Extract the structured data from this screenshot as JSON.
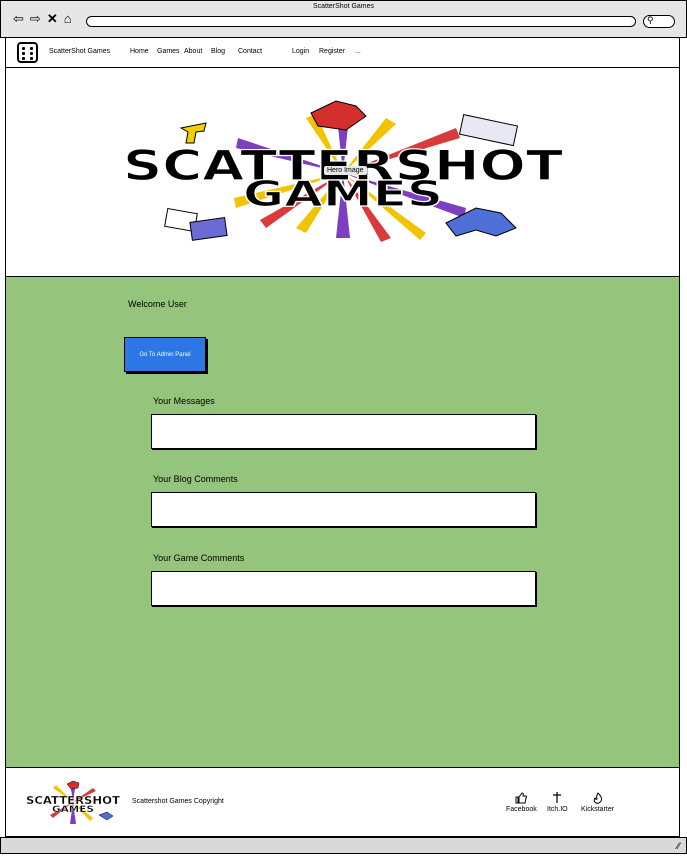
{
  "window": {
    "title": "ScatterShot Games"
  },
  "browser": {
    "icons": [
      "back-icon",
      "forward-icon",
      "close-icon",
      "home-icon",
      "search-icon"
    ]
  },
  "nav": {
    "brand": "ScatterShot Games",
    "items": [
      "Home",
      "Games",
      "About",
      "Blog",
      "Contact"
    ],
    "login": "Login",
    "register": "Register",
    "more": "..."
  },
  "hero": {
    "logo_text_line1": "SCATTERSHOT",
    "logo_text_line2": "GAMES",
    "label": "Hero Image"
  },
  "main": {
    "welcome": "Welcome User",
    "admin_button": "Go To Admin Panel",
    "sections": [
      {
        "label": "Your Messages"
      },
      {
        "label": "Your Blog Comments"
      },
      {
        "label": "Your Game Comments"
      }
    ]
  },
  "footer": {
    "logo_text_line1": "SCATTERSHOT",
    "logo_text_line2": "GAMES",
    "copyright": "Scattershot Games Copyright",
    "social": [
      {
        "label": "Facebook",
        "icon": "thumbs-up-icon"
      },
      {
        "label": "Itch.IO",
        "icon": "dagger-icon"
      },
      {
        "label": "Kickstarter",
        "icon": "flame-icon"
      }
    ]
  },
  "colors": {
    "main_bg": "#95c47c",
    "button_bg": "#2b78e4",
    "chrome_bg": "#e6e6e6"
  }
}
